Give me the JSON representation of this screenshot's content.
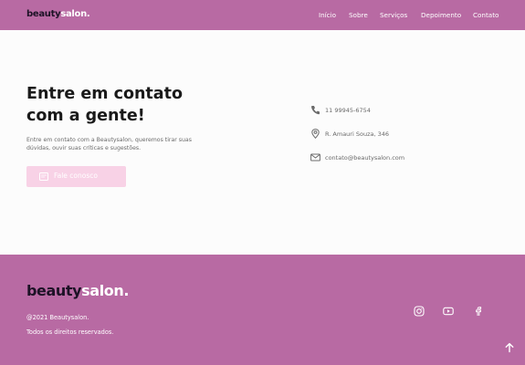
{
  "header": {
    "logo_part1": "beauty",
    "logo_part2": "salon.",
    "nav": [
      "Início",
      "Sobre",
      "Serviços",
      "Depoimento",
      "Contato"
    ]
  },
  "main": {
    "title_line1": "Entre em contato",
    "title_line2": "com a gente!",
    "description": "Entre em contato com a Beautysalon, queremos tirar suas dúvidas, ouvir suas críticas e sugestões.",
    "cta_label": "Fale conosco",
    "cta_icon": "whatsapp-icon",
    "contacts": [
      {
        "icon": "phone-icon",
        "text": "11 99945-6754"
      },
      {
        "icon": "location-pin-icon",
        "text": "R. Amauri Souza, 346"
      },
      {
        "icon": "mail-icon",
        "text": "contato@beautysalon.com"
      }
    ]
  },
  "footer": {
    "logo_part1": "beauty",
    "logo_part2": "salon.",
    "copyright": "@2021 Beautysalon.",
    "rights": "Todos os direitos reservados.",
    "social": [
      "instagram-icon",
      "youtube-icon",
      "facebook-icon"
    ],
    "back_to_top_icon": "arrow-up-icon"
  },
  "colors": {
    "brand": "#b86aa3",
    "dark": "#1d1226",
    "cta_bg": "#f8d2e6"
  }
}
